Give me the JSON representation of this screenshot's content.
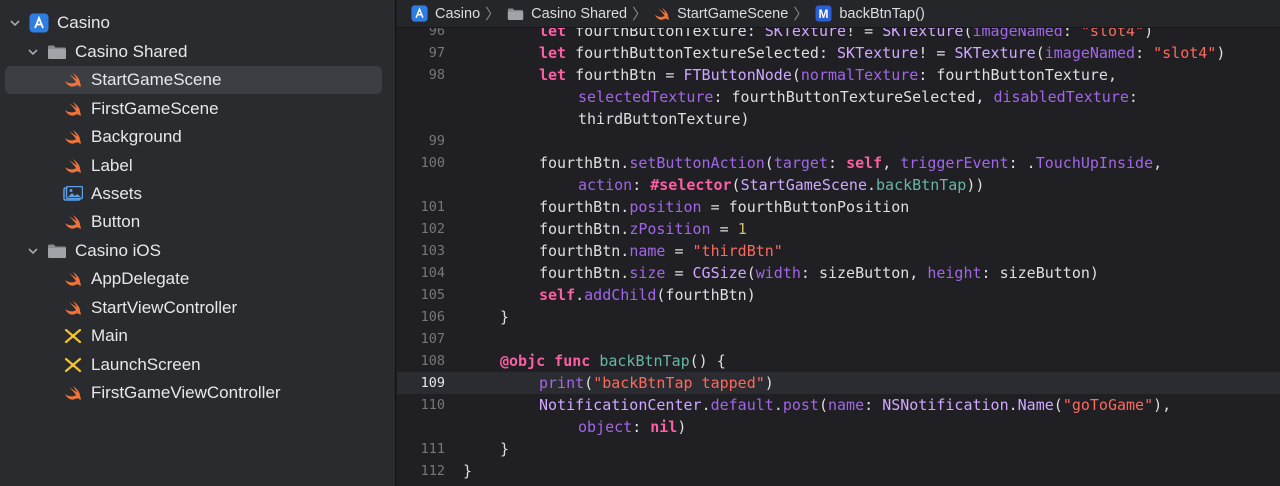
{
  "sidebar": {
    "project": "Casino",
    "items": [
      {
        "label": "Casino",
        "kind": "app-icon"
      },
      {
        "label": "Casino Shared",
        "kind": "folder-icon"
      },
      {
        "label": "StartGameScene",
        "kind": "swift-icon"
      },
      {
        "label": "FirstGameScene",
        "kind": "swift-icon"
      },
      {
        "label": "Background",
        "kind": "swift-icon"
      },
      {
        "label": "Label",
        "kind": "swift-icon"
      },
      {
        "label": "Assets",
        "kind": "assets-icon"
      },
      {
        "label": "Button",
        "kind": "swift-icon"
      },
      {
        "label": "Casino iOS",
        "kind": "folder-icon"
      },
      {
        "label": "AppDelegate",
        "kind": "swift-icon"
      },
      {
        "label": "StartViewController",
        "kind": "swift-icon"
      },
      {
        "label": "Main",
        "kind": "storyboard-icon"
      },
      {
        "label": "LaunchScreen",
        "kind": "storyboard-icon"
      },
      {
        "label": "FirstGameViewController",
        "kind": "swift-icon"
      }
    ],
    "selected": "StartGameScene"
  },
  "jumpbar": {
    "crumbs": [
      "Casino",
      "Casino Shared",
      "StartGameScene",
      "backBtnTap()"
    ],
    "method_badge": "M"
  },
  "editor": {
    "current_line": "109",
    "gutter": [
      "96",
      "97",
      "98",
      "",
      "",
      "99",
      "100",
      "",
      "101",
      "102",
      "103",
      "104",
      "105",
      "106",
      "107",
      "108",
      "109",
      "110",
      "",
      "111",
      "112"
    ],
    "lines": [
      [
        [
          "k",
          "let "
        ],
        [
          "pl",
          "fourthButtonTexture: "
        ],
        [
          "t",
          "SKTexture"
        ],
        [
          "pl",
          "! = "
        ],
        [
          "t",
          "SKTexture"
        ],
        [
          "pl",
          "("
        ],
        [
          "p",
          "imageNamed"
        ],
        [
          "pl",
          ": "
        ],
        [
          "s",
          "\"slot4\""
        ],
        [
          "pl",
          ")"
        ]
      ],
      [
        [
          "k",
          "let "
        ],
        [
          "pl",
          "fourthButtonTextureSelected: "
        ],
        [
          "t",
          "SKTexture"
        ],
        [
          "pl",
          "! = "
        ],
        [
          "t",
          "SKTexture"
        ],
        [
          "pl",
          "("
        ],
        [
          "p",
          "imageNamed"
        ],
        [
          "pl",
          ": "
        ],
        [
          "s",
          "\"slot4\""
        ],
        [
          "pl",
          ")"
        ]
      ],
      [
        [
          "k",
          "let "
        ],
        [
          "pl",
          "fourthBtn = "
        ],
        [
          "t",
          "FTButtonNode"
        ],
        [
          "pl",
          "("
        ],
        [
          "p",
          "normalTexture"
        ],
        [
          "pl",
          ": fourthButtonTexture,"
        ]
      ],
      [
        [
          "p",
          "selectedTexture"
        ],
        [
          "pl",
          ": fourthButtonTextureSelected, "
        ],
        [
          "p",
          "disabledTexture"
        ],
        [
          "pl",
          ":"
        ]
      ],
      [
        [
          "pl",
          "thirdButtonTexture)"
        ]
      ],
      [],
      [
        [
          "pl",
          "fourthBtn."
        ],
        [
          "p",
          "setButtonAction"
        ],
        [
          "pl",
          "("
        ],
        [
          "p",
          "target"
        ],
        [
          "pl",
          ": "
        ],
        [
          "k",
          "self"
        ],
        [
          "pl",
          ", "
        ],
        [
          "p",
          "triggerEvent"
        ],
        [
          "pl",
          ": ."
        ],
        [
          "p",
          "TouchUpInside"
        ],
        [
          "pl",
          ","
        ]
      ],
      [
        [
          "p",
          "action"
        ],
        [
          "pl",
          ": "
        ],
        [
          "k",
          "#selector"
        ],
        [
          "pl",
          "("
        ],
        [
          "t",
          "StartGameScene"
        ],
        [
          "pl",
          "."
        ],
        [
          "f",
          "backBtnTap"
        ],
        [
          "pl",
          "))"
        ]
      ],
      [
        [
          "pl",
          "fourthBtn."
        ],
        [
          "p",
          "position"
        ],
        [
          "pl",
          " = fourthButtonPosition"
        ]
      ],
      [
        [
          "pl",
          "fourthBtn."
        ],
        [
          "p",
          "zPosition"
        ],
        [
          "pl",
          " = "
        ],
        [
          "n",
          "1"
        ]
      ],
      [
        [
          "pl",
          "fourthBtn."
        ],
        [
          "p",
          "name"
        ],
        [
          "pl",
          " = "
        ],
        [
          "s",
          "\"thirdBtn\""
        ]
      ],
      [
        [
          "pl",
          "fourthBtn."
        ],
        [
          "p",
          "size"
        ],
        [
          "pl",
          " = "
        ],
        [
          "t",
          "CGSize"
        ],
        [
          "pl",
          "("
        ],
        [
          "p",
          "width"
        ],
        [
          "pl",
          ": sizeButton, "
        ],
        [
          "p",
          "height"
        ],
        [
          "pl",
          ": sizeButton)"
        ]
      ],
      [
        [
          "k",
          "self"
        ],
        [
          "pl",
          "."
        ],
        [
          "p",
          "addChild"
        ],
        [
          "pl",
          "(fourthBtn)"
        ]
      ],
      [
        [
          "pl",
          "}"
        ]
      ],
      [],
      [
        [
          "k",
          "@objc func "
        ],
        [
          "f",
          "backBtnTap"
        ],
        [
          "pl",
          "() {"
        ]
      ],
      [
        [
          "p",
          "print"
        ],
        [
          "pl",
          "("
        ],
        [
          "s",
          "\"backBtnTap tapped\""
        ],
        [
          "pl",
          ")"
        ]
      ],
      [
        [
          "t",
          "NotificationCenter"
        ],
        [
          "pl",
          "."
        ],
        [
          "p",
          "default"
        ],
        [
          "pl",
          "."
        ],
        [
          "p",
          "post"
        ],
        [
          "pl",
          "("
        ],
        [
          "p",
          "name"
        ],
        [
          "pl",
          ": "
        ],
        [
          "t",
          "NSNotification"
        ],
        [
          "pl",
          "."
        ],
        [
          "t",
          "Name"
        ],
        [
          "pl",
          "("
        ],
        [
          "s",
          "\"goToGame\""
        ],
        [
          "pl",
          "),"
        ]
      ],
      [
        [
          "p",
          "object"
        ],
        [
          "pl",
          ": "
        ],
        [
          "k",
          "nil"
        ],
        [
          "pl",
          ")"
        ]
      ],
      [
        [
          "pl",
          "}"
        ]
      ],
      [
        [
          "pl",
          "}"
        ]
      ]
    ]
  },
  "colors": {
    "keyword": "#fc5fa3",
    "type": "#d0a8ff",
    "property": "#a167e6",
    "string": "#fc6a5d",
    "number": "#d0bf69",
    "function": "#67b7a4",
    "selection": "#3d3e43",
    "swift_orange": "#f0743a",
    "folder_blue": "#5da0e8"
  }
}
